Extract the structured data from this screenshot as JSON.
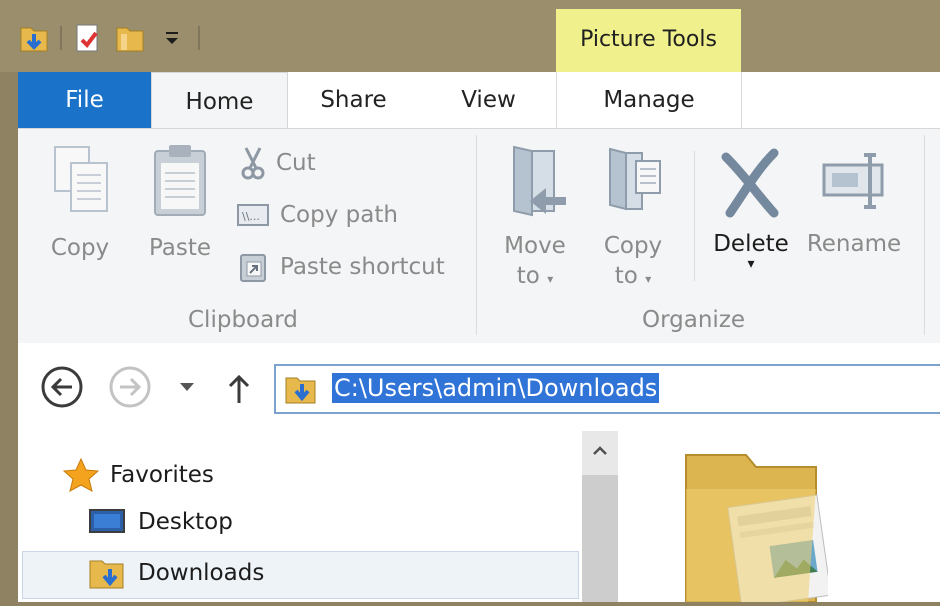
{
  "title_bar": {
    "contextual_tab_group": "Picture Tools"
  },
  "tabs": {
    "file": "File",
    "home": "Home",
    "share": "Share",
    "view": "View",
    "manage": "Manage"
  },
  "ribbon": {
    "clipboard": {
      "copy": "Copy",
      "paste": "Paste",
      "cut": "Cut",
      "copy_path": "Copy path",
      "paste_shortcut": "Paste shortcut",
      "group_label": "Clipboard"
    },
    "organize": {
      "move_to_line1": "Move",
      "move_to_line2": "to",
      "copy_to_line1": "Copy",
      "copy_to_line2": "to",
      "delete": "Delete",
      "rename": "Rename",
      "group_label": "Organize"
    }
  },
  "address": {
    "path": "C:\\Users\\admin\\Downloads"
  },
  "navigation": {
    "favorites": "Favorites",
    "desktop": "Desktop",
    "downloads": "Downloads"
  },
  "colors": {
    "file_tab": "#1a73c9",
    "contextual_tab": "#f0f08c",
    "selection": "#3074d8",
    "title_bar": "#9a8e6c"
  }
}
